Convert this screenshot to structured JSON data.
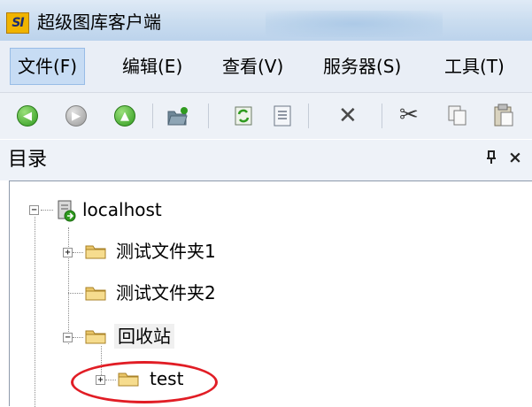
{
  "window": {
    "logo_text": "SI",
    "title": "超级图库客户端"
  },
  "menu": [
    {
      "label": "文件(F)"
    },
    {
      "label": "编辑(E)"
    },
    {
      "label": "查看(V)"
    },
    {
      "label": "服务器(S)"
    },
    {
      "label": "工具(T)"
    }
  ],
  "toolbar": {
    "back_glyph": "◀",
    "forward_glyph": "▶",
    "up_glyph": "▲",
    "delete_glyph": "✕",
    "cut_glyph": "✂"
  },
  "panel": {
    "title": "目录",
    "pin_glyph": "ᵖ",
    "close_glyph": "×"
  },
  "tree": {
    "root": "localhost",
    "items": [
      "测试文件夹1",
      "测试文件夹2",
      "回收站",
      "test"
    ]
  },
  "colors": {
    "highlight_circle": "#e11d25",
    "menu_active": "#c7dcf4"
  }
}
